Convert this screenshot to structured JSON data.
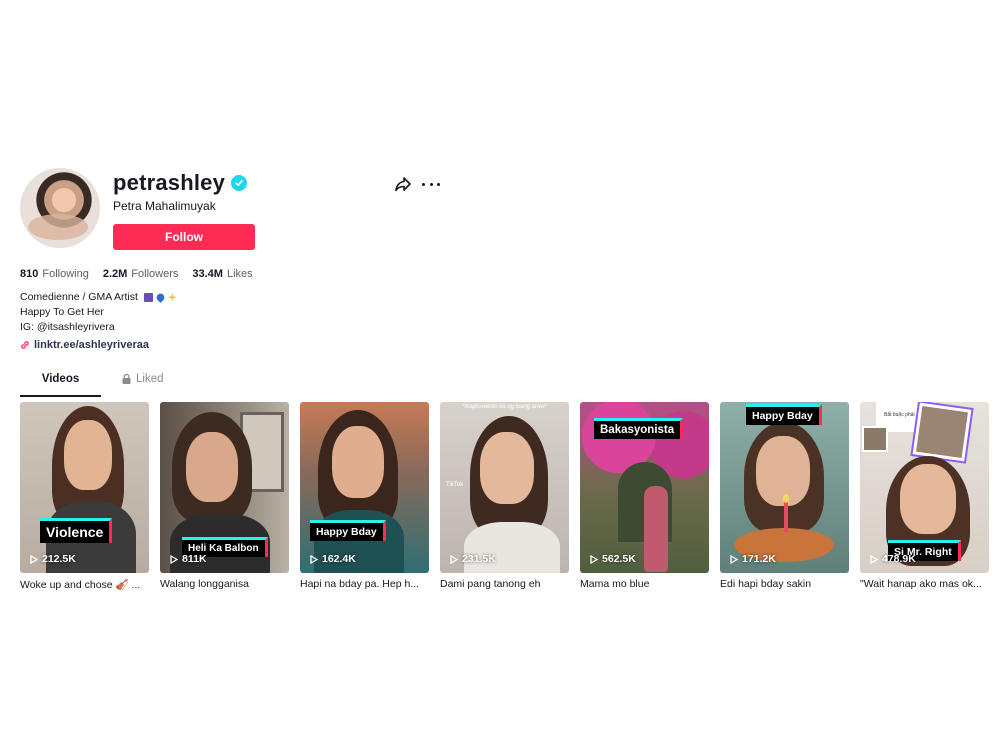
{
  "profile": {
    "username": "petrashley",
    "nickname": "Petra Mahalimuyak",
    "follow_label": "Follow",
    "verified_icon": "verified-badge-icon",
    "share_icon": "share-icon",
    "more_icon": "more-icon"
  },
  "stats": {
    "following_count": "810",
    "following_label": "Following",
    "followers_count": "2.2M",
    "followers_label": "Followers",
    "likes_count": "33.4M",
    "likes_label": "Likes"
  },
  "bio": {
    "line1": "Comedienne / GMA Artist",
    "line2": "Happy To Get Her",
    "line3": "IG: @itsashleyrivera",
    "link": "linktr.ee/ashleyriveraa"
  },
  "tabs": {
    "videos": "Videos",
    "liked": "Liked"
  },
  "videos": [
    {
      "label": "Violence",
      "views": "212.5K",
      "caption": "Woke up and chose 🎻 ..."
    },
    {
      "label": "Heli Ka Balbon",
      "views": "811K",
      "caption": "Walang longganisa"
    },
    {
      "label": "Happy Bday",
      "views": "162.4K",
      "caption": "Hapi na bday pa. Hep h..."
    },
    {
      "label": "",
      "views": "231.5K",
      "caption": "Dami pang tanong eh",
      "top_text": "*Nagkuwento ka ng isang araw*",
      "watermark": "TikTok"
    },
    {
      "label": "Bakasyonista",
      "views": "562.5K",
      "caption": "Mama mo blue"
    },
    {
      "label": "Happy Bday",
      "views": "171.2K",
      "caption": "Edi hapi bday sakin"
    },
    {
      "label": "Si Mr. Right",
      "views": "478.9K",
      "caption": "\"Wait hanap ako mas ok...",
      "top_text": "Bắt buộc phải"
    }
  ],
  "colors": {
    "accent": "#fe2c55",
    "cyan": "#25f4ee",
    "verified": "#20d5ec",
    "text": "#161823",
    "muted": "#5d5e66"
  }
}
